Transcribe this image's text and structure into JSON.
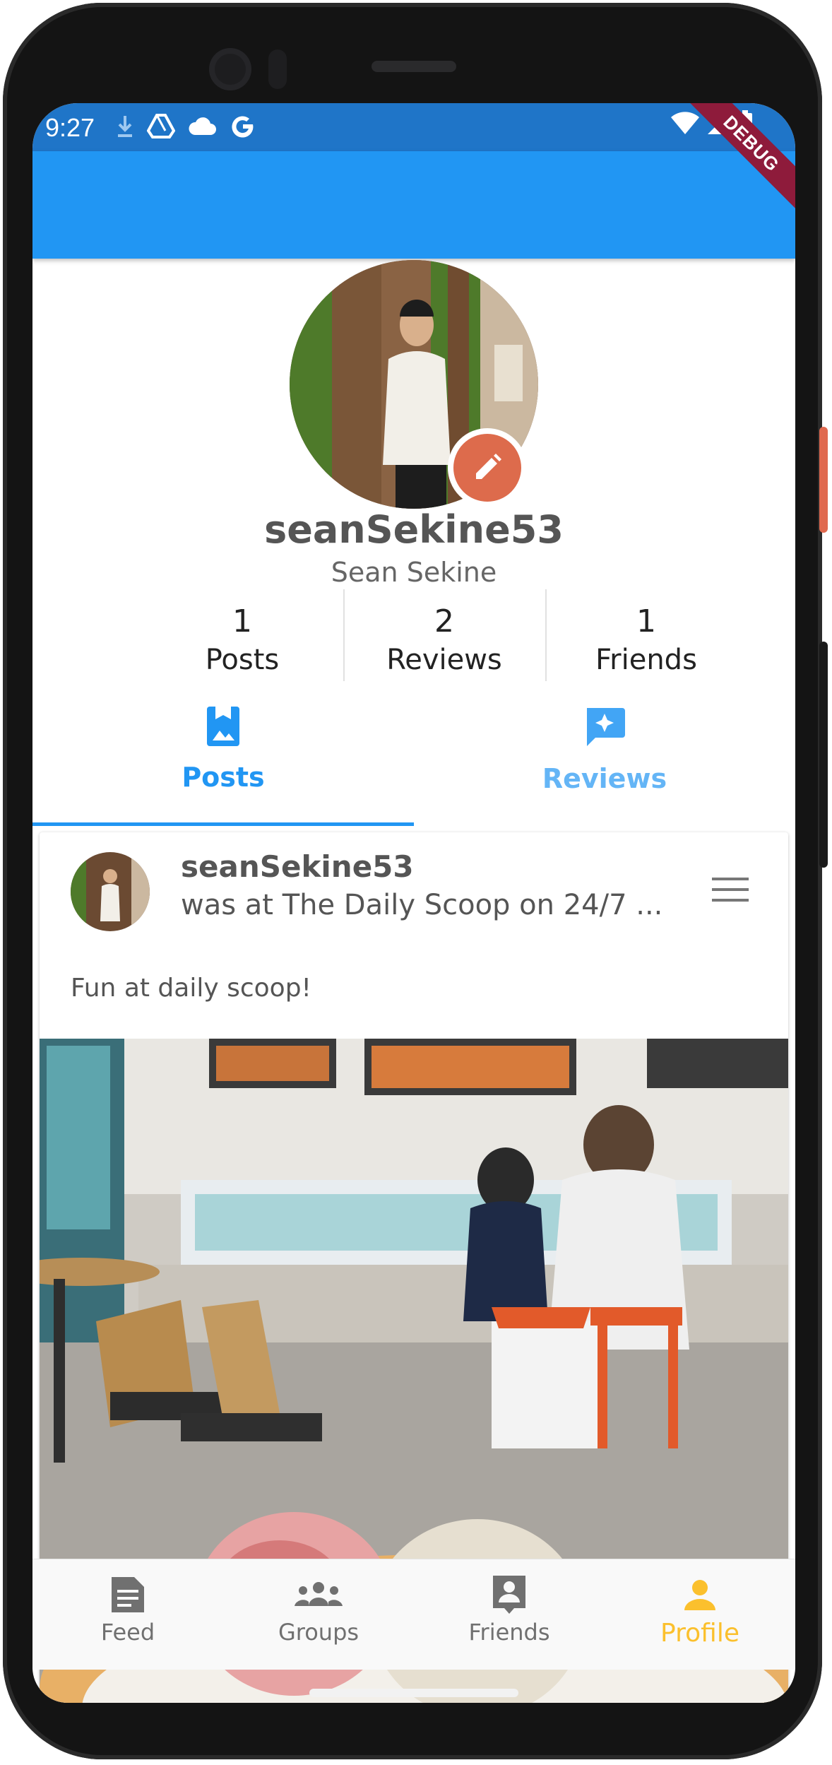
{
  "status_bar": {
    "time": "9:27"
  },
  "debug_banner": "DEBUG",
  "profile": {
    "username": "seanSekine53",
    "full_name": "Sean Sekine",
    "stats": [
      {
        "value": "1",
        "label": "Posts"
      },
      {
        "value": "2",
        "label": "Reviews"
      },
      {
        "value": "1",
        "label": "Friends"
      }
    ]
  },
  "tabs": [
    {
      "label": "Posts",
      "icon": "bookmark-image-icon",
      "active": true
    },
    {
      "label": "Reviews",
      "icon": "review-sparkle-icon",
      "active": false
    }
  ],
  "post": {
    "username": "seanSekine53",
    "subtitle": "was at The Daily Scoop on 24/7 ...",
    "text": "Fun at daily scoop!"
  },
  "bottom_nav": [
    {
      "label": "Feed",
      "icon": "article-icon",
      "active": false
    },
    {
      "label": "Groups",
      "icon": "groups-icon",
      "active": false
    },
    {
      "label": "Friends",
      "icon": "contact-icon",
      "active": false
    },
    {
      "label": "Profile",
      "icon": "person-icon",
      "active": true
    }
  ],
  "colors": {
    "app_bar": "#2196f3",
    "status_bar": "#1f75c8",
    "accent_blue": "#2196f3",
    "inactive_tab": "#64b5f6",
    "edit_fab": "#dd6b4c",
    "active_nav": "#fbc02d",
    "inactive_nav": "#707070"
  }
}
